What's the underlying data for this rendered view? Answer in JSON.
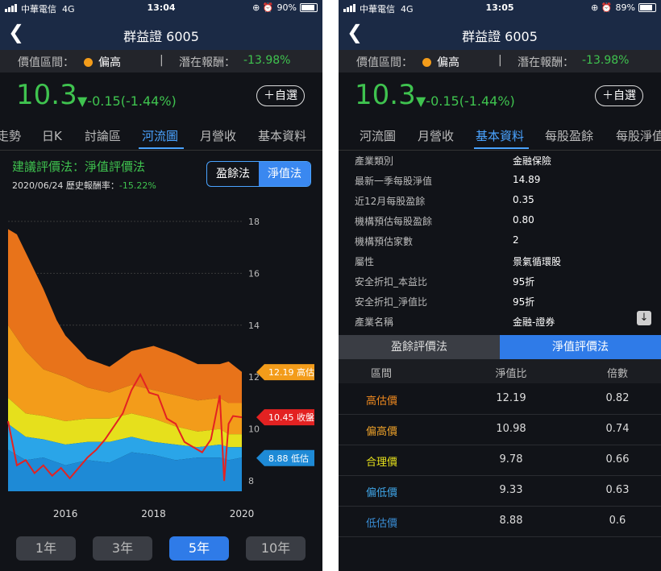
{
  "colors": {
    "up": "#3fc34f",
    "accent": "#4aa3ff",
    "orange": "#f39c1a",
    "red": "#e32222",
    "blue": "#1e8ad6",
    "yellow": "#e6e01c"
  },
  "panel1": {
    "status": {
      "carrier": "中華電信",
      "network": "4G",
      "time": "13:04",
      "battery": "90%"
    },
    "nav": {
      "title": "群益證 6005"
    },
    "valuation": {
      "label": "價值區間：",
      "level": "偏高",
      "sep": "|",
      "return_label": "潛在報酬：",
      "return_value": "-13.98%"
    },
    "price": {
      "value": "10.3",
      "change": "▼-0.15(-1.44%)",
      "watch_label": "＋自選"
    },
    "tabs": [
      "走勢",
      "日K",
      "討論區",
      "河流圖",
      "月營收",
      "基本資料"
    ],
    "active_tab": "河流圖",
    "method_title": "建議評價法：淨值評價法",
    "date": "2020/06/24",
    "hist_label": "歷史報酬率：",
    "hist_value": "-15.22%",
    "seg": [
      "盈餘法",
      "淨值法"
    ],
    "ranges": [
      "1年",
      "3年",
      "5年",
      "10年"
    ],
    "active_range": "5年"
  },
  "chart_data": {
    "type": "area",
    "title": "",
    "y_ticks": [
      "18",
      "16",
      "14",
      "12",
      "10",
      "8"
    ],
    "ylim": [
      7.6,
      18.4
    ],
    "x_ticks": [
      "2016",
      "2018",
      "2020"
    ],
    "xlim": [
      2015.2,
      2020.5
    ],
    "grid": true,
    "series_order": [
      "低估價",
      "偏低價",
      "合理價",
      "偏高價",
      "高估價"
    ],
    "series": [
      {
        "name": "低估價",
        "x": [
          2015.2,
          2015.6,
          2016.0,
          2016.5,
          2017.0,
          2017.5,
          2018.0,
          2018.5,
          2019.0,
          2019.5,
          2020.0,
          2020.2,
          2020.5
        ],
        "values": [
          9.2,
          8.8,
          8.9,
          8.6,
          8.8,
          8.7,
          9.1,
          9.0,
          8.8,
          8.9,
          8.9,
          8.8,
          8.9
        ]
      },
      {
        "name": "偏低價",
        "x": [
          2015.2,
          2015.6,
          2016.0,
          2016.5,
          2017.0,
          2017.5,
          2018.0,
          2018.5,
          2019.0,
          2019.5,
          2020.0,
          2020.2,
          2020.5
        ],
        "values": [
          10.2,
          9.7,
          9.6,
          9.4,
          9.5,
          9.5,
          9.7,
          9.5,
          9.4,
          9.3,
          9.4,
          9.3,
          9.3
        ]
      },
      {
        "name": "合理價",
        "x": [
          2015.2,
          2015.6,
          2016.0,
          2016.5,
          2017.0,
          2017.5,
          2018.0,
          2018.5,
          2019.0,
          2019.5,
          2020.0,
          2020.2,
          2020.5
        ],
        "values": [
          11.2,
          10.6,
          10.5,
          10.3,
          10.4,
          10.4,
          10.6,
          10.4,
          10.1,
          9.9,
          10.0,
          9.8,
          9.8
        ]
      },
      {
        "name": "偏高價",
        "x": [
          2015.2,
          2015.6,
          2016.0,
          2016.5,
          2017.0,
          2017.5,
          2018.0,
          2018.5,
          2019.0,
          2019.5,
          2020.0,
          2020.2,
          2020.5
        ],
        "values": [
          14.0,
          13.0,
          12.3,
          12.0,
          11.6,
          11.4,
          11.7,
          11.5,
          11.3,
          11.1,
          11.2,
          11.0,
          11.0
        ]
      },
      {
        "name": "高估價",
        "x": [
          2015.2,
          2015.4,
          2015.6,
          2016.0,
          2016.3,
          2016.5,
          2017.0,
          2017.5,
          2018.0,
          2018.5,
          2019.0,
          2019.5,
          2020.0,
          2020.2,
          2020.5
        ],
        "values": [
          17.7,
          17.5,
          16.8,
          15.4,
          14.2,
          13.6,
          12.7,
          12.4,
          13.0,
          13.2,
          12.9,
          12.5,
          12.5,
          12.6,
          12.2
        ]
      },
      {
        "name": "收盤",
        "x": [
          2015.2,
          2015.4,
          2015.6,
          2015.8,
          2016.0,
          2016.2,
          2016.4,
          2016.6,
          2016.8,
          2017.0,
          2017.2,
          2017.4,
          2017.6,
          2017.8,
          2018.0,
          2018.2,
          2018.4,
          2018.6,
          2018.8,
          2019.0,
          2019.2,
          2019.4,
          2019.6,
          2019.8,
          2020.0,
          2020.1,
          2020.2,
          2020.3,
          2020.5
        ],
        "values": [
          10.3,
          8.6,
          8.8,
          8.3,
          8.6,
          8.2,
          8.5,
          8.1,
          8.5,
          8.9,
          9.2,
          9.6,
          10.1,
          10.6,
          11.5,
          12.1,
          11.4,
          11.3,
          10.4,
          10.2,
          9.5,
          9.3,
          9.1,
          9.6,
          11.3,
          8.0,
          10.2,
          10.5,
          10.45
        ]
      }
    ],
    "end_labels": [
      {
        "text": "12.19 高估",
        "value": 12.19,
        "color": "#f39c1a"
      },
      {
        "text": "10.45 收盤",
        "value": 10.45,
        "color": "#e32222"
      },
      {
        "text": "8.88 低估",
        "value": 8.88,
        "color": "#1e8ad6"
      }
    ]
  },
  "panel2": {
    "status": {
      "carrier": "中華電信",
      "network": "4G",
      "time": "13:05",
      "battery": "89%"
    },
    "nav": {
      "title": "群益證 6005"
    },
    "valuation": {
      "label": "價值區間：",
      "level": "偏高",
      "sep": "|",
      "return_label": "潛在報酬：",
      "return_value": "-13.98%"
    },
    "price": {
      "value": "10.3",
      "change": "▼-0.15(-1.44%)",
      "watch_label": "＋自選"
    },
    "tabs": [
      "河流圖",
      "月營收",
      "基本資料",
      "每股盈餘",
      "每股淨值"
    ],
    "active_tab": "基本資料",
    "info": [
      {
        "k": "產業類別",
        "v": "金融保險"
      },
      {
        "k": "最新一季每股淨值",
        "v": "14.89"
      },
      {
        "k": "近12月每股盈餘",
        "v": "0.35"
      },
      {
        "k": "機構預估每股盈餘",
        "v": "0.80"
      },
      {
        "k": "機構預估家數",
        "v": "2"
      },
      {
        "k": "屬性",
        "v": "景氣循環股"
      },
      {
        "k": "安全折扣_本益比",
        "v": "95折"
      },
      {
        "k": "安全折扣_淨值比",
        "v": "95折"
      },
      {
        "k": "產業名稱",
        "v": "金融-證券"
      }
    ],
    "methods": [
      "盈餘評價法",
      "淨值評價法"
    ],
    "table_headers": [
      "區間",
      "淨值比",
      "倍數"
    ],
    "table_rows": [
      {
        "name": "高估價",
        "pbr": "12.19",
        "mult": "0.82",
        "color": "#f08a1f"
      },
      {
        "name": "偏高價",
        "pbr": "10.98",
        "mult": "0.74",
        "color": "#f0a32a"
      },
      {
        "name": "合理價",
        "pbr": "9.78",
        "mult": "0.66",
        "color": "#e6e01c"
      },
      {
        "name": "偏低價",
        "pbr": "9.33",
        "mult": "0.63",
        "color": "#3fa6e8"
      },
      {
        "name": "低估價",
        "pbr": "8.88",
        "mult": "0.6",
        "color": "#3a8ed6"
      }
    ]
  }
}
